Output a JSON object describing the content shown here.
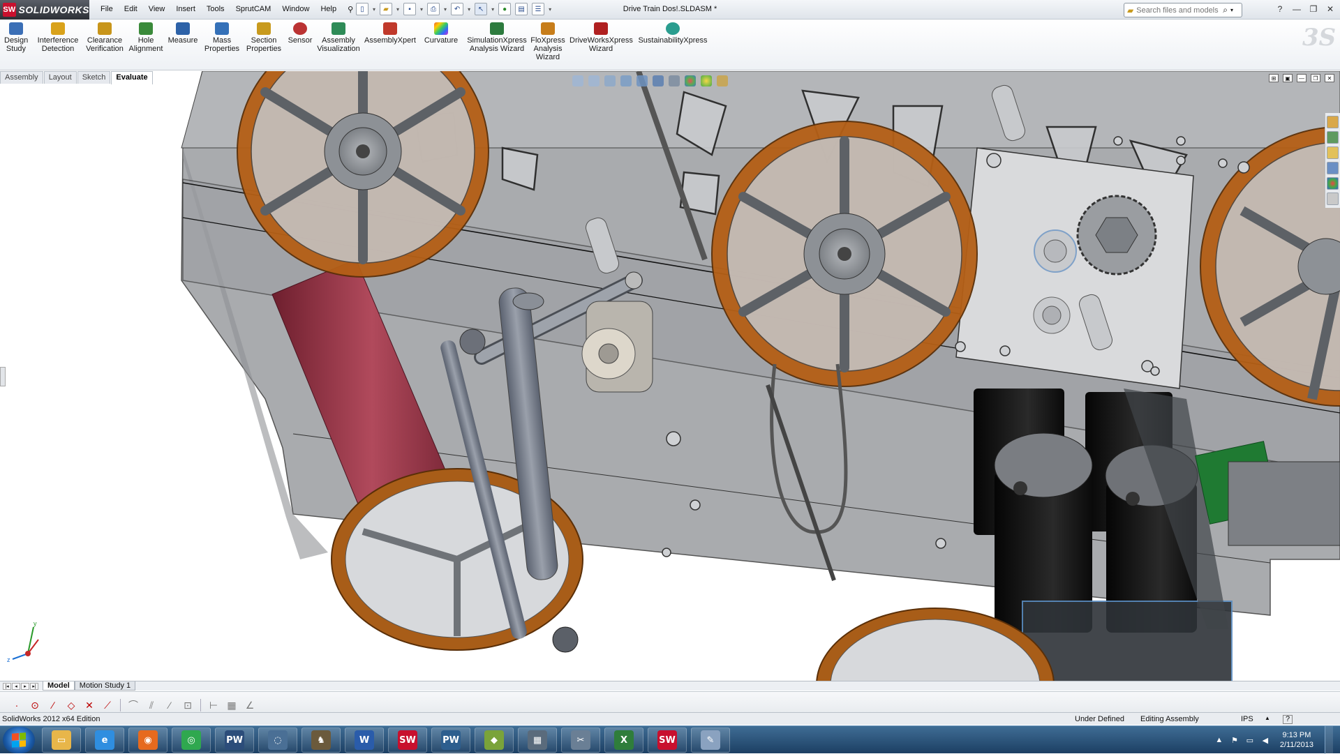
{
  "app": {
    "logo_text": "SOLIDWORKS",
    "logo_mark": "SW",
    "document_title": "Drive Train Dos!.SLDASM *"
  },
  "menu": [
    "File",
    "Edit",
    "View",
    "Insert",
    "Tools",
    "SprutCAM",
    "Window",
    "Help"
  ],
  "search": {
    "placeholder": "Search files and models"
  },
  "ribbon": {
    "tools": [
      {
        "label": "Design\nStudy",
        "icon": "design-study-icon",
        "color": "#3b6fb6"
      },
      {
        "label": "Interference\nDetection",
        "icon": "interference-icon",
        "color": "#d9a21b"
      },
      {
        "label": "Clearance\nVerification",
        "icon": "clearance-icon",
        "color": "#c8951a"
      },
      {
        "label": "Hole\nAlignment",
        "icon": "hole-alignment-icon",
        "color": "#3a8a3a"
      },
      {
        "label": "Measure",
        "icon": "measure-icon",
        "color": "#2d62a8"
      },
      {
        "label": "Mass\nProperties",
        "icon": "mass-properties-icon",
        "color": "#3571b8"
      },
      {
        "label": "Section\nProperties",
        "icon": "section-properties-icon",
        "color": "#c89a1d"
      },
      {
        "label": "Sensor",
        "icon": "sensor-icon",
        "color": "#b33"
      },
      {
        "label": "Assembly\nVisualization",
        "icon": "assembly-visualization-icon",
        "color": "#2e8b57"
      },
      {
        "label": "AssemblyXpert",
        "icon": "assemblyxpert-icon",
        "color": "#c0392b"
      },
      {
        "label": "Curvature",
        "icon": "curvature-icon",
        "color": "#8e44ad"
      },
      {
        "label": "SimulationXpress\nAnalysis Wizard",
        "icon": "simulationxpress-icon",
        "color": "#2d7b3e"
      },
      {
        "label": "FloXpress\nAnalysis\nWizard",
        "icon": "floxpress-icon",
        "color": "#c77d1a"
      },
      {
        "label": "DriveWorksXpress\nWizard",
        "icon": "driveworksxpress-icon",
        "color": "#b02020"
      },
      {
        "label": "SustainabilityXpress",
        "icon": "sustainabilityxpress-icon",
        "color": "#2a9d8f"
      }
    ]
  },
  "command_tabs": [
    "Assembly",
    "Layout",
    "Sketch",
    "Evaluate"
  ],
  "active_command_tab": "Evaluate",
  "bottom_tabs": [
    "Model",
    "Motion Study 1"
  ],
  "status": {
    "edition": "SolidWorks 2012 x64 Edition",
    "definition": "Under Defined",
    "mode": "Editing Assembly",
    "units": "IPS",
    "help": "?"
  },
  "taskbar": {
    "apps": [
      {
        "name": "explorer",
        "glyph": "▭",
        "color": "#e8b64a"
      },
      {
        "name": "internet-explorer",
        "glyph": "e",
        "color": "#2f8ee0"
      },
      {
        "name": "firefox",
        "glyph": "◉",
        "color": "#e66a1e"
      },
      {
        "name": "chrome",
        "glyph": "◎",
        "color": "#2fa84f"
      },
      {
        "name": "pw",
        "glyph": "PW",
        "color": "#2c4d7a"
      },
      {
        "name": "edrawings",
        "glyph": "◌",
        "color": "#4a6f95"
      },
      {
        "name": "gimp",
        "glyph": "♞",
        "color": "#6b5a3c"
      },
      {
        "name": "word",
        "glyph": "W",
        "color": "#2a5caa"
      },
      {
        "name": "solidworks",
        "glyph": "SW",
        "color": "#c8102e"
      },
      {
        "name": "pw3d",
        "glyph": "PW",
        "color": "#2d5e8e"
      },
      {
        "name": "sketchup",
        "glyph": "◆",
        "color": "#7aa33a"
      },
      {
        "name": "calculator",
        "glyph": "▦",
        "color": "#5a6b7c"
      },
      {
        "name": "snipping",
        "glyph": "✂",
        "color": "#6a7f95"
      },
      {
        "name": "excel",
        "glyph": "X",
        "color": "#2f7d3b"
      },
      {
        "name": "solidworks-active",
        "glyph": "SW",
        "color": "#c8102e"
      },
      {
        "name": "paint",
        "glyph": "✎",
        "color": "#8aa2c0"
      }
    ]
  },
  "clock": {
    "time": "9:13 PM",
    "date": "2/11/2013"
  }
}
